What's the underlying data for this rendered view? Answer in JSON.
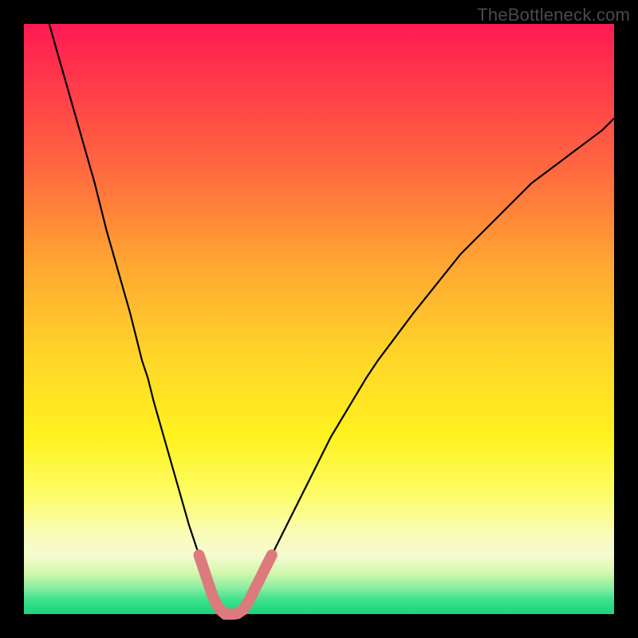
{
  "watermark": "TheBottleneck.com",
  "colors": {
    "frame": "#000000",
    "curve": "#000000",
    "highlight_fill": "#dd7a7d",
    "highlight_stroke": "#dd7a7d"
  },
  "chart_data": {
    "type": "line",
    "title": "",
    "xlabel": "",
    "ylabel": "",
    "xlim": [
      0,
      100
    ],
    "ylim": [
      0,
      100
    ],
    "grid": false,
    "legend": false,
    "note": "Bottleneck-style V-curve. x is normalized horizontal position (0–100) corresponding to the plot area; y is the curve height as percent of plot-area height (0 = bottom, 100 = top). The minimum (notch) lies roughly at x≈33–37 where y≈0. The green band spans roughly y∈[0,8]; below it the curve is highlighted in salmon.",
    "x": [
      0,
      2,
      4,
      6,
      8,
      10,
      12,
      14,
      16,
      18,
      19,
      20,
      21,
      22,
      24,
      26,
      28,
      29,
      30,
      31,
      32,
      33,
      34,
      35,
      36,
      37,
      38,
      39,
      40,
      42,
      44,
      46,
      48,
      50,
      52,
      55,
      58,
      60,
      63,
      66,
      70,
      74,
      78,
      82,
      86,
      90,
      94,
      98,
      100
    ],
    "values": [
      115,
      108,
      101,
      94,
      87,
      80,
      73,
      65,
      58,
      51,
      47,
      43,
      40,
      36,
      29,
      22,
      15,
      12,
      9,
      6,
      3,
      1,
      0,
      0,
      0,
      0.5,
      2,
      4,
      6,
      10,
      14,
      18,
      22,
      26,
      30,
      35,
      40,
      43,
      47,
      51,
      56,
      61,
      65,
      69,
      73,
      76,
      79,
      82,
      84
    ],
    "highlight_range_x": [
      29.5,
      40.0
    ],
    "highlight_band_y": [
      0,
      10
    ]
  }
}
